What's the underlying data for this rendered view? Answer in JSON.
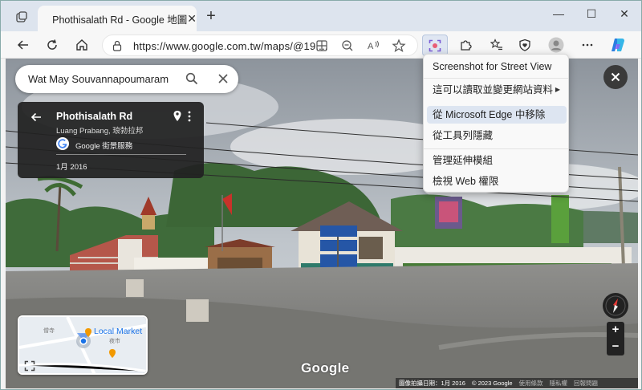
{
  "browser": {
    "tab_title": "Phothisalath Rd - Google 地圖",
    "url": "https://www.google.com.tw/maps/@19....",
    "new_tab": "+",
    "minimize": "—",
    "maximize": "☐",
    "close": "✕"
  },
  "extension_menu": {
    "items": [
      {
        "label": "Screenshot for Street View"
      },
      {
        "label": "這可以讀取並變更網站資料"
      },
      {
        "label": "從 Microsoft Edge 中移除"
      },
      {
        "label": "從工具列隱藏"
      },
      {
        "label": "管理延伸模組"
      },
      {
        "label": "檢視 Web 權限"
      }
    ]
  },
  "map": {
    "search_value": "Wat May Souvannapoumaram",
    "info_card": {
      "title": "Phothisalath Rd",
      "subtitle": "Luang Prabang, 琅勃拉邦",
      "provider": "Google 街景服務",
      "date": "1月 2016"
    },
    "minimap": {
      "label_local": "Local Market",
      "label_local_sub": "夜市",
      "label_temple": "僧寺"
    },
    "watermark": "Google",
    "footer": {
      "capture_date": "圖像拍攝日期：1月 2016",
      "copyright": "© 2023 Google",
      "terms": "使用條款",
      "privacy": "隱私權",
      "report": "回報問題"
    },
    "zoom_in": "+",
    "zoom_out": "−"
  },
  "colors": {
    "accent": "#1a73e8",
    "menu_highlight": "#dde5f1",
    "card_bg": "#212121"
  }
}
